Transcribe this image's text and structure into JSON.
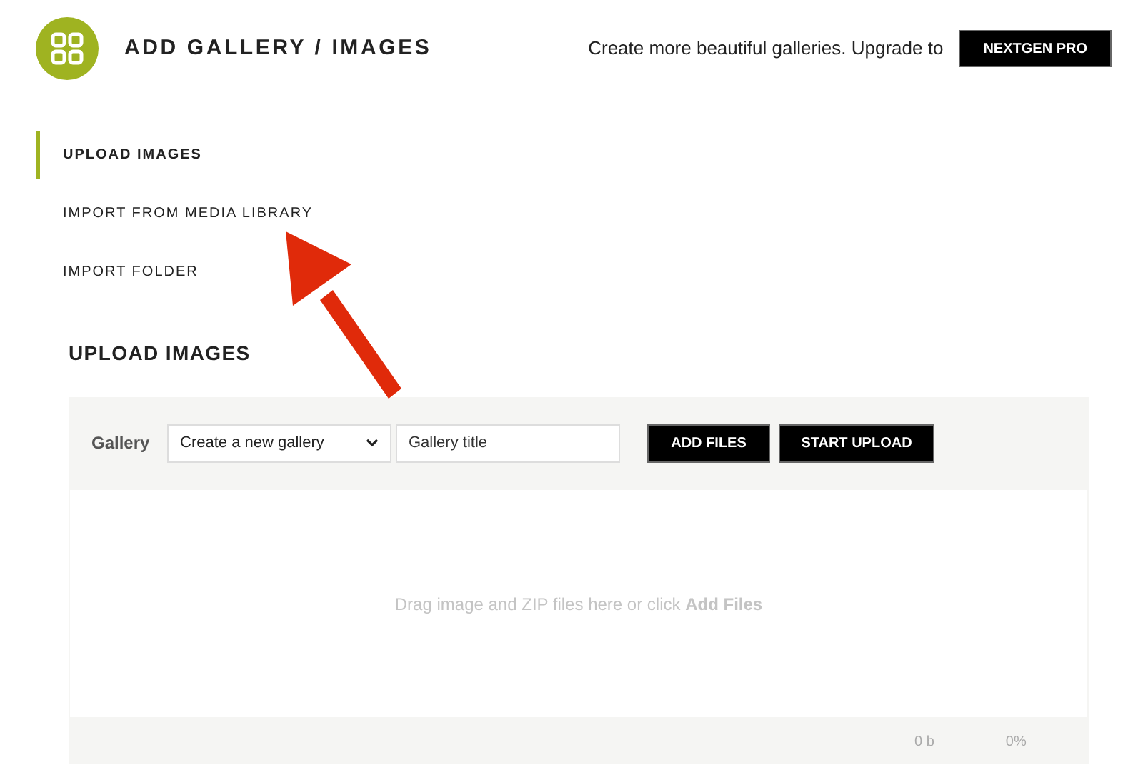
{
  "header": {
    "title": "ADD GALLERY / IMAGES",
    "promo_text": "Create more beautiful galleries. Upgrade to",
    "promo_button": "NEXTGEN PRO"
  },
  "tabs": [
    {
      "label": "UPLOAD IMAGES",
      "selected": true
    },
    {
      "label": "IMPORT FROM MEDIA LIBRARY",
      "selected": false
    },
    {
      "label": "IMPORT FOLDER",
      "selected": false
    }
  ],
  "section_title": "UPLOAD IMAGES",
  "uploader": {
    "gallery_label": "Gallery",
    "gallery_select": "Create a new gallery",
    "title_field": {
      "placeholder": "Gallery title"
    },
    "buttons": [
      "ADD FILES",
      "START UPLOAD"
    ],
    "drop_hint": "Drag image and ZIP files here or click **Add Files**",
    "total_size": "0 b",
    "progress": "0%"
  }
}
